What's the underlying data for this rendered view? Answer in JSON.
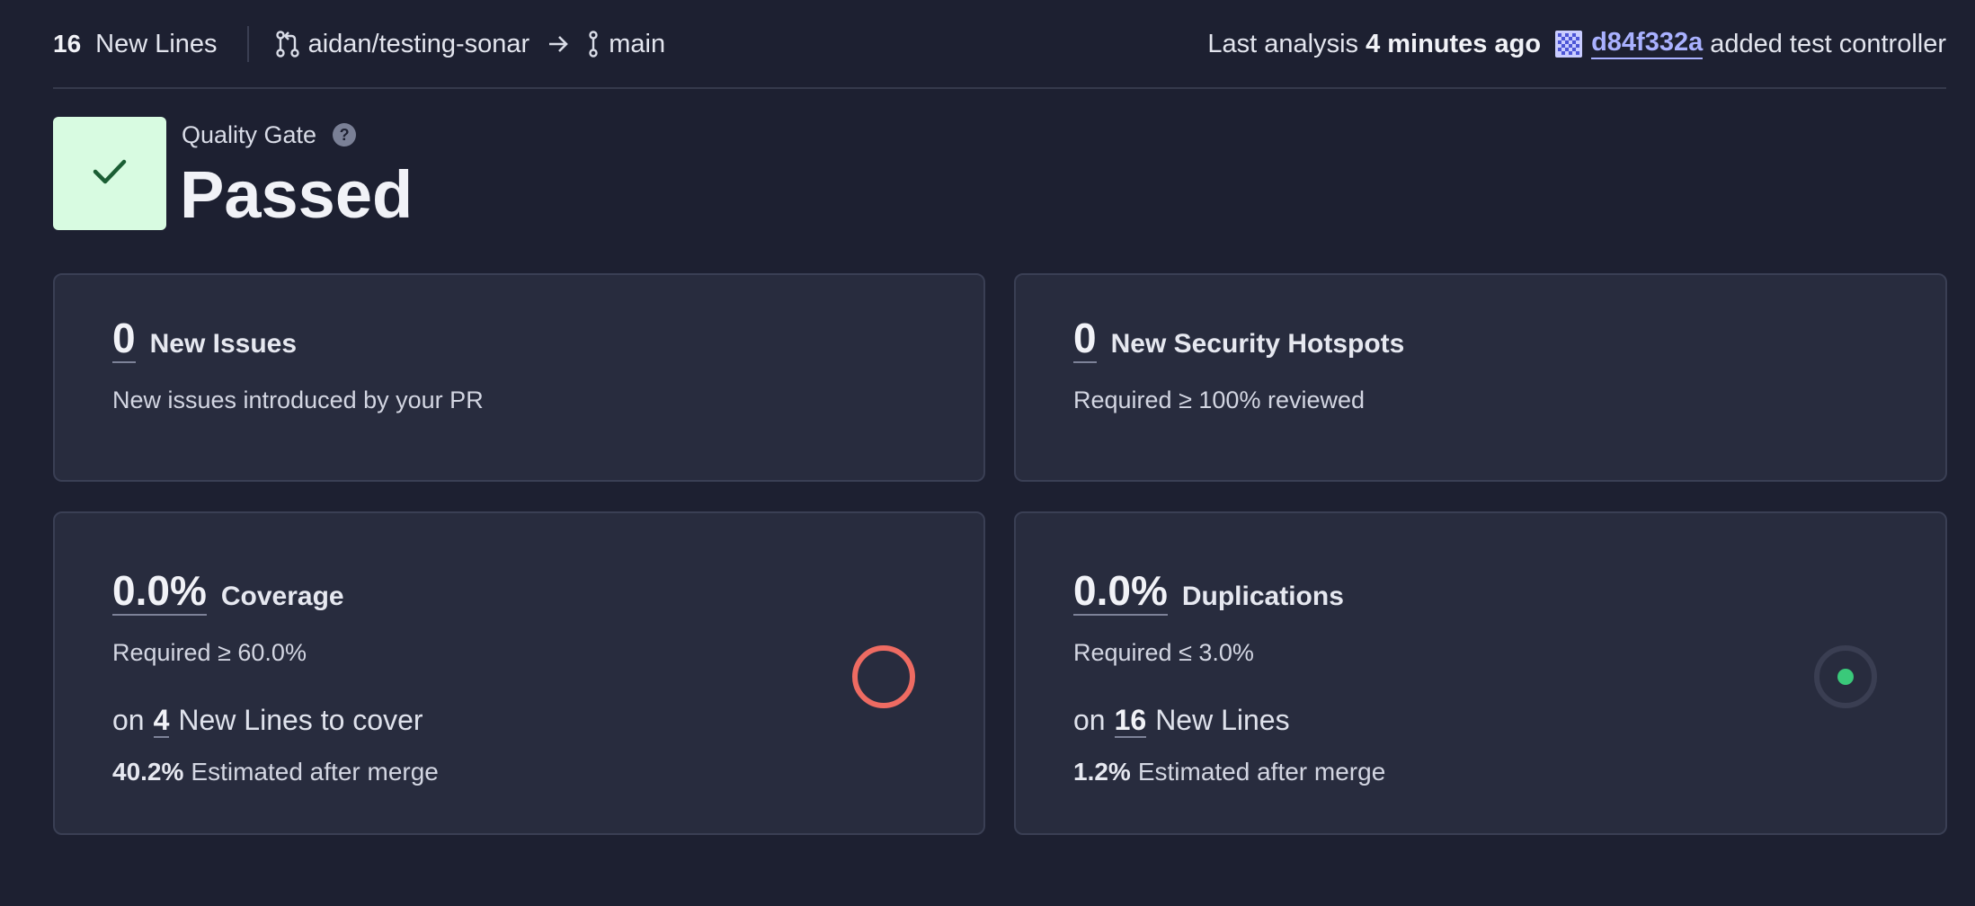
{
  "header": {
    "new_lines_count": "16",
    "new_lines_label": "New Lines",
    "source_branch": "aidan/testing-sonar",
    "target_branch": "main",
    "analysis_label": "Last analysis",
    "analysis_time": "4 minutes ago",
    "commit_hash": "d84f332a",
    "commit_message": "added test controller"
  },
  "quality_gate": {
    "label": "Quality Gate",
    "help": "?",
    "status": "Passed"
  },
  "cards": {
    "issues": {
      "value": "0",
      "name": "New Issues",
      "sub": "New issues introduced by your PR"
    },
    "hotspots": {
      "value": "0",
      "name": "New Security Hotspots",
      "sub": "Required ≥ 100% reviewed"
    },
    "coverage": {
      "value": "0.0%",
      "name": "Coverage",
      "sub": "Required ≥ 60.0%",
      "on_prefix": "on",
      "on_count": "4",
      "on_suffix": "New Lines to cover",
      "estimate_value": "40.2%",
      "estimate_label": "Estimated after merge"
    },
    "duplications": {
      "value": "0.0%",
      "name": "Duplications",
      "sub": "Required ≤ 3.0%",
      "on_prefix": "on",
      "on_count": "16",
      "on_suffix": "New Lines",
      "estimate_value": "1.2%",
      "estimate_label": "Estimated after merge"
    }
  },
  "icons": {
    "pull_request": "pull-request-icon",
    "arrow": "arrow-right-icon",
    "branch": "branch-icon",
    "avatar": "avatar-icon",
    "check": "check-icon",
    "coverage_gauge": "coverage-gauge-icon",
    "duplication_gauge": "duplication-gauge-icon"
  },
  "colors": {
    "background": "#1d2031",
    "card": "#282c3e",
    "passed_badge": "#d8fbe1",
    "passed_check": "#1b5e34",
    "link": "#a9b1ff",
    "coverage_ring": "#ee6b62",
    "duplication_dot": "#3ac97a"
  }
}
